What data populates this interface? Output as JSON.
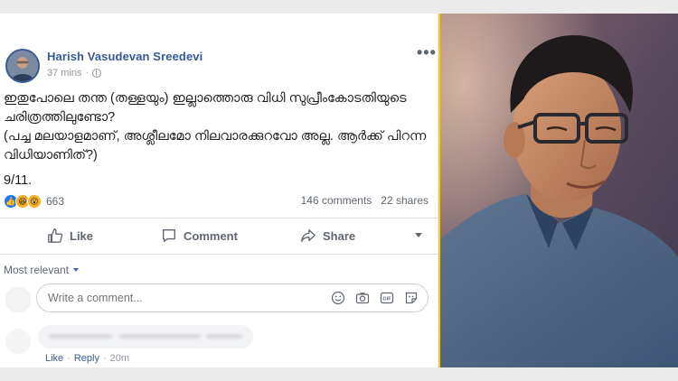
{
  "post": {
    "author": "Harish Vasudevan Sreedevi",
    "time": "37 mins",
    "separator": "·",
    "paragraph1": "ഇതുപോലെ തന്ത (തള്ളയും) ഇല്ലാത്തൊരു വിധി സുപ്രീംകോടതിയുടെ ചരിത്രത്തിലുണ്ടോ?",
    "paragraph2": "(പച്ച മലയാളമാണ്, അശ്ലീലമോ നിലവാരക്കുറവോ അല്ല. ആർക്ക് പിറന്ന വിധിയാണിത്?)",
    "paragraph3": "9/11.",
    "reaction_count": "663",
    "comments_count": "146 comments",
    "shares_count": "22 shares"
  },
  "actions": {
    "like": "Like",
    "comment": "Comment",
    "share": "Share"
  },
  "comments": {
    "sort_label": "Most relevant",
    "input_placeholder": "Write a comment...",
    "like_link": "Like",
    "reply_link": "Reply",
    "separator": "·",
    "time": "20m"
  },
  "icons": {
    "more": "more-options-icon",
    "privacy": "globe-icon",
    "reactions": [
      "like-reaction-icon",
      "haha-reaction-icon",
      "wow-reaction-icon"
    ],
    "comment_tools": [
      "emoji-icon",
      "camera-icon",
      "gif-icon",
      "sticker-icon"
    ]
  },
  "colors": {
    "link_blue": "#385898",
    "photo_border": "#f4d000",
    "like_blue": "#2078f4"
  }
}
